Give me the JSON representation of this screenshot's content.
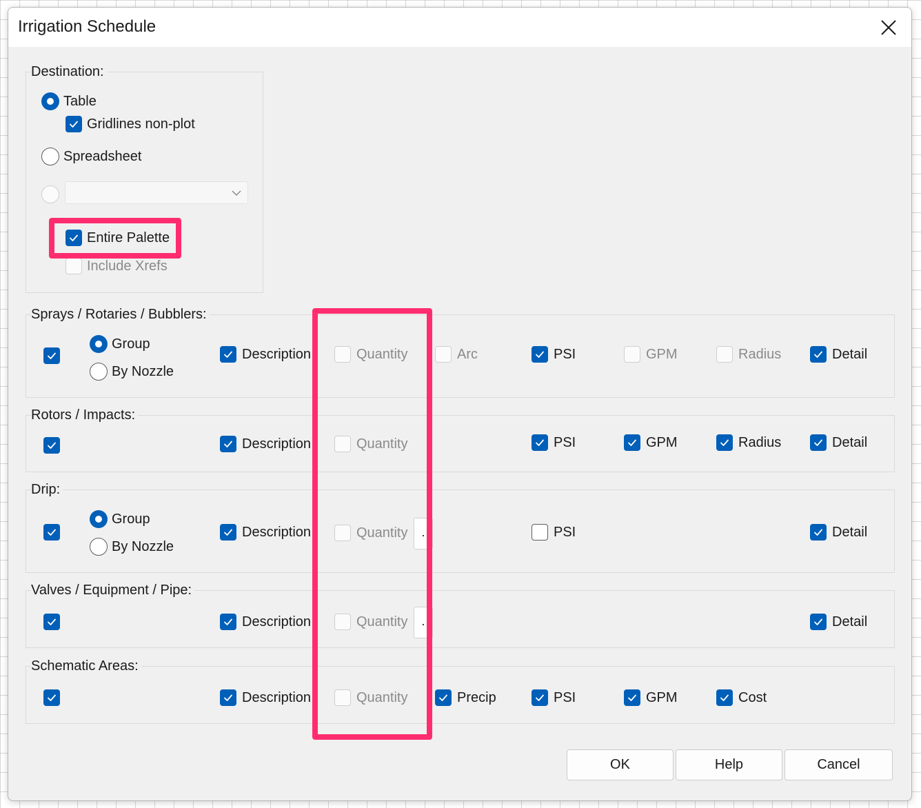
{
  "dialog": {
    "title": "Irrigation Schedule",
    "close_icon": "close-icon"
  },
  "destination": {
    "label": "Destination:",
    "table": "Table",
    "gridlines": "Gridlines non-plot",
    "spreadsheet": "Spreadsheet",
    "combo_value": "",
    "entire_palette": "Entire Palette",
    "include_xrefs": "Include Xrefs"
  },
  "sprays": {
    "label": "Sprays / Rotaries / Bubblers:",
    "group": "Group",
    "by_nozzle": "By Nozzle",
    "description": "Description",
    "quantity": "Quantity",
    "arc": "Arc",
    "psi": "PSI",
    "gpm": "GPM",
    "radius": "Radius",
    "detail": "Detail"
  },
  "rotors": {
    "label": "Rotors / Impacts:",
    "description": "Description",
    "quantity": "Quantity",
    "psi": "PSI",
    "gpm": "GPM",
    "radius": "Radius",
    "detail": "Detail"
  },
  "drip": {
    "label": "Drip:",
    "group": "Group",
    "by_nozzle": "By Nozzle",
    "description": "Description",
    "quantity": "Quantity",
    "more": ".",
    "psi": "PSI",
    "detail": "Detail"
  },
  "valves": {
    "label": "Valves / Equipment / Pipe:",
    "description": "Description",
    "quantity": "Quantity",
    "more": ".",
    "detail": "Detail"
  },
  "schematic": {
    "label": "Schematic Areas:",
    "description": "Description",
    "quantity": "Quantity",
    "precip": "Precip",
    "psi": "PSI",
    "gpm": "GPM",
    "cost": "Cost"
  },
  "buttons": {
    "ok": "OK",
    "help": "Help",
    "cancel": "Cancel"
  },
  "colors": {
    "accent": "#005fb8",
    "highlight": "#ff2d6f",
    "dialog_bg": "#f0f0f0"
  }
}
